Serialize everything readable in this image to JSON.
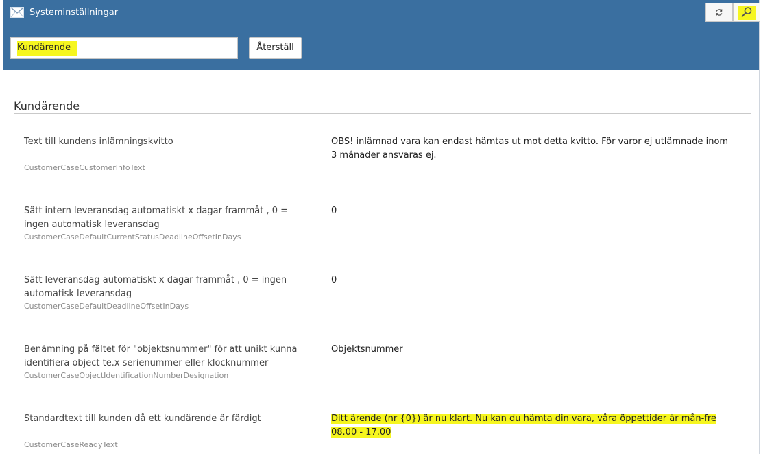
{
  "window": {
    "title": "Systeminställningar",
    "icon": "envelope-icon",
    "refresh_icon": "refresh-icon",
    "search_icon": "search-icon",
    "accent_color": "#3a6fa0",
    "highlight_color": "#f6f61f"
  },
  "search": {
    "value": "Kundärende",
    "reset_label": "Återställ"
  },
  "section": {
    "title": "Kundärende"
  },
  "settings": [
    {
      "label": "Text till kundens inlämningskvitto",
      "key": "CustomerCaseCustomerInfoText",
      "value": "OBS! inlämnad vara kan endast hämtas ut mot detta kvitto. För varor ej utlämnade inom 3 månader ansvaras ej."
    },
    {
      "label": "Sätt intern leveransdag automatiskt x dagar frammåt , 0 = ingen automatisk leveransdag",
      "key": "CustomerCaseDefaultCurrentStatusDeadlineOffsetInDays",
      "value": "0"
    },
    {
      "label": "Sätt leveransdag automatiskt x dagar frammåt , 0 = ingen automatisk leveransdag",
      "key": "CustomerCaseDefaultDeadlineOffsetInDays",
      "value": "0"
    },
    {
      "label": "Benämning på fältet för \"objektsnummer\" för att unikt kunna identifiera object te.x serienummer eller klocknummer",
      "key": "CustomerCaseObjectIdentificationNumberDesignation",
      "value": "Objektsnummer"
    },
    {
      "label": "Standardtext till kunden då ett kundärende är färdigt",
      "key": "CustomerCaseReadyText",
      "value": "Ditt ärende (nr {0}) är nu klart. Nu kan du hämta din vara, våra öppettider är mån-fre 08.00 - 17.00"
    }
  ]
}
